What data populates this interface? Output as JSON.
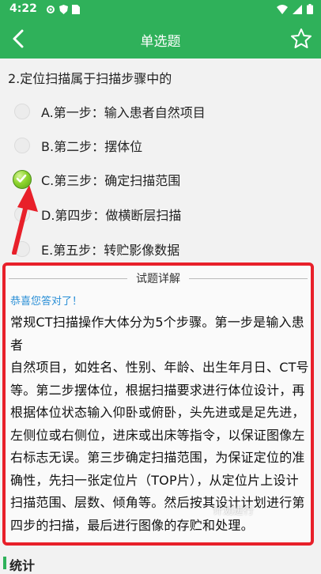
{
  "status_bar": {
    "time": "4:22"
  },
  "app_bar": {
    "title": "单选题"
  },
  "question": {
    "text": "2.定位扫描属于扫描步骤中的"
  },
  "options": [
    {
      "label": "A.第一步：输入患者自然项目",
      "selected": false
    },
    {
      "label": "B.第二步：摆体位",
      "selected": false
    },
    {
      "label": "C.第三步：确定扫描范围",
      "selected": true
    },
    {
      "label": "D.第四步：做横断层扫描",
      "selected": false
    },
    {
      "label": "E.第五步：转贮影像数据",
      "selected": false
    }
  ],
  "detail": {
    "title": "试题详解",
    "congrats": "恭喜您答对了！",
    "lines": [
      "常规CT扫描操作大体分为5个步骤。第一步是输入患者",
      "自然项目，如姓名、性别、年龄、出生年月日、CT号",
      "等。第二步摆体位，根据扫描要求进行体位设计，再",
      "根据体位状态输入仰卧或俯卧，头先进或是足先进，",
      "左侧位或右侧位，进床或出床等指令，以保证图像左",
      "右标志无误。第三步确定扫描范围，为保证定位的准",
      "确性，先扫一张定位片（TOP片），从定位片上设计",
      "扫描范围、层数、倾角等。然后按其设计计划进行第",
      "四步的扫描，最后进行图像的存贮和处理。"
    ],
    "watermark": "计划进行"
  },
  "next_section": {
    "title": "统计"
  },
  "colors": {
    "primary": "#2fb15a",
    "highlight": "#e8202a",
    "congrats": "#2a8fd6"
  }
}
